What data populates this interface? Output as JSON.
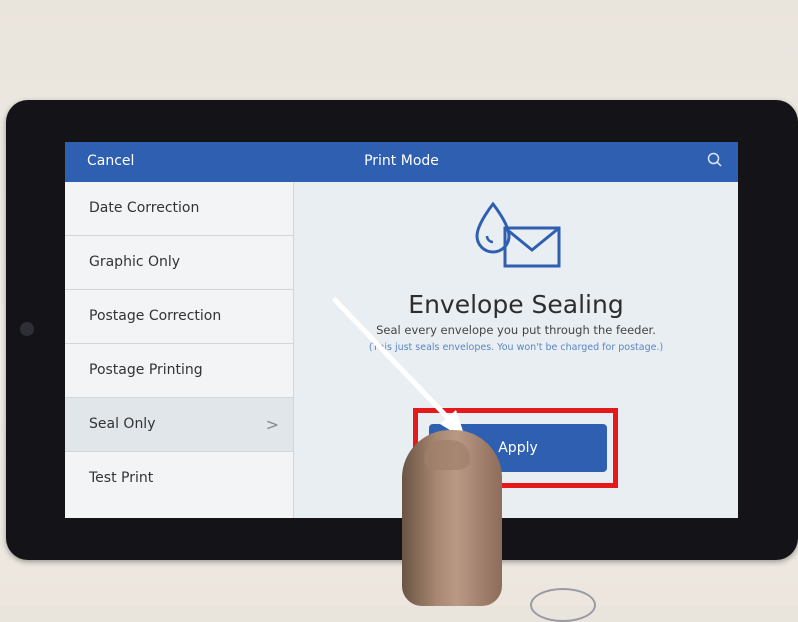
{
  "header": {
    "cancel_label": "Cancel",
    "title": "Print Mode",
    "search_icon": "search-icon"
  },
  "sidebar": {
    "items": [
      {
        "label": "Date Correction"
      },
      {
        "label": "Graphic Only"
      },
      {
        "label": "Postage Correction"
      },
      {
        "label": "Postage Printing"
      },
      {
        "label": "Seal Only",
        "selected": true
      },
      {
        "label": "Test Print"
      }
    ]
  },
  "main": {
    "icon": "envelope-drop-icon",
    "heading": "Envelope Sealing",
    "description": "Seal every envelope you put through the feeder.",
    "note": "(This just seals envelopes. You won't be charged for postage.)",
    "apply_label": "Apply"
  },
  "colors": {
    "accent": "#2e5fb0",
    "highlight": "#e5191b",
    "note": "#5a85c4"
  }
}
